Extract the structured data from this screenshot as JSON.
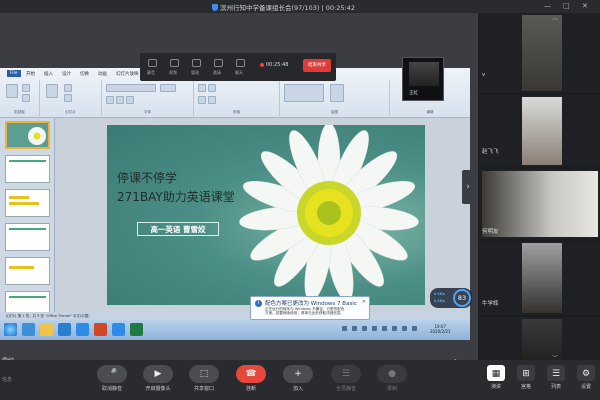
{
  "window": {
    "title": "滨州行知中学备课组长会(97/103) | 00:25:42",
    "minimize": "—",
    "maximize": "□",
    "close": "✕"
  },
  "meeting_toolbar": {
    "timer": "00:25:48",
    "stop_share": "结束共享",
    "labels": [
      "静音",
      "视频",
      "管理",
      "邀请",
      "聊天"
    ]
  },
  "ppt": {
    "tabs": [
      "File",
      "开始",
      "插入",
      "设计",
      "切换",
      "动画",
      "幻灯片放映",
      "审阅",
      "视图",
      "加载项"
    ],
    "groups": [
      "剪贴板",
      "幻灯片",
      "字体",
      "段落",
      "绘图",
      "编辑"
    ],
    "slide": {
      "line1": "停课不停学",
      "line2": "271BAY助力英语课堂",
      "author": "高一英语 曹雪姣"
    },
    "status_text": "幻灯片 第 1 张，共 9 张  \"Office Theme\"  中文(中国)",
    "clock_time": "19:07",
    "clock_date": "2020/2/21"
  },
  "notification": {
    "title": "配色方案已更改为 Windows 7 Basic",
    "body_line1": "正在运行的程序与 Windows 不兼容，已更改配色",
    "body_line2": "方案。若要继续使用，请单击此处获取详细信息。"
  },
  "network": {
    "up": "0.4K/s",
    "down": "0.4K/s",
    "percent": "83"
  },
  "self_cam_name": "王虹",
  "sharer_name": "雪姣",
  "participants": [
    {
      "name": "v"
    },
    {
      "name": "赵飞飞"
    },
    {
      "name": "何明友"
    },
    {
      "name": "牛学辉"
    },
    {
      "name": ""
    }
  ],
  "bottom": {
    "left_label": "信息",
    "buttons": [
      {
        "icon": "🎤",
        "label": "取消静音"
      },
      {
        "icon": "▶",
        "label": "开启摄像头"
      },
      {
        "icon": "⬚",
        "label": "共享窗口"
      },
      {
        "icon": "☎",
        "label": "挂断"
      },
      {
        "icon": "+",
        "label": "加入"
      },
      {
        "icon": "☰",
        "label": "全员静音"
      },
      {
        "icon": "●",
        "label": "录制"
      }
    ],
    "view_buttons": [
      {
        "icon": "▦",
        "label": "演讲"
      },
      {
        "icon": "⊞",
        "label": "宫格"
      },
      {
        "icon": "☰",
        "label": "列表"
      },
      {
        "icon": "⚙",
        "label": "设置"
      }
    ]
  },
  "colors": {
    "hangup": "#e8473b",
    "stop_share": "#e03b3b",
    "accent_blue": "#3a8ef0",
    "slide_green": "#4b8e85",
    "flower_center": "#e6e21f"
  }
}
